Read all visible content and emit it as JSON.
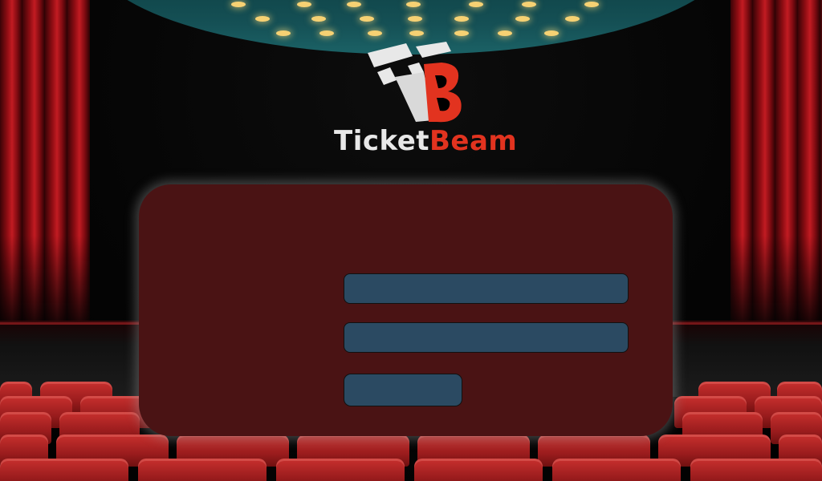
{
  "app": {
    "brand_part1": "Ticket",
    "brand_part2": "Beam"
  },
  "colors": {
    "brand_white": "#e8e8e8",
    "brand_red": "#e2331f",
    "card_bg": "#4a1314",
    "field_bg": "#2b4a62"
  },
  "form": {
    "field1_value": "",
    "field1_placeholder": "",
    "field2_value": "",
    "field2_placeholder": "",
    "submit_label": ""
  },
  "icons": {
    "logo": "ticketbeam-logo-icon"
  }
}
